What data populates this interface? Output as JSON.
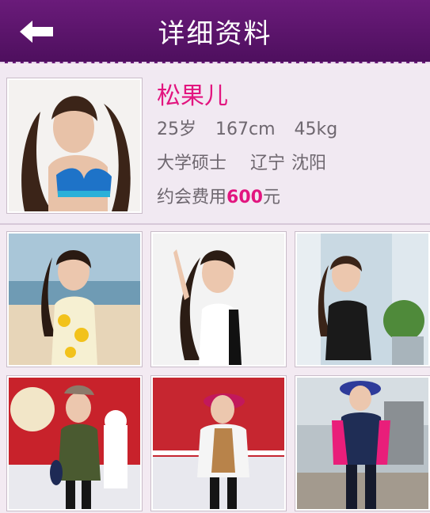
{
  "header": {
    "title": "详细资料",
    "back_icon": "back-arrow-icon"
  },
  "profile": {
    "name": "松果儿",
    "age": "25岁",
    "height": "167cm",
    "weight": "45kg",
    "education": "大学硕士",
    "province": "辽宁",
    "city": "沈阳",
    "fee_label": "约会费用",
    "fee_amount": "600",
    "fee_unit": "元"
  },
  "colors": {
    "header": "#5c1470",
    "accent": "#e2157f",
    "background": "#f3eaf2"
  },
  "gallery": {
    "photos": [
      "photo-1",
      "photo-2",
      "photo-3",
      "photo-4",
      "photo-5",
      "photo-6"
    ]
  }
}
